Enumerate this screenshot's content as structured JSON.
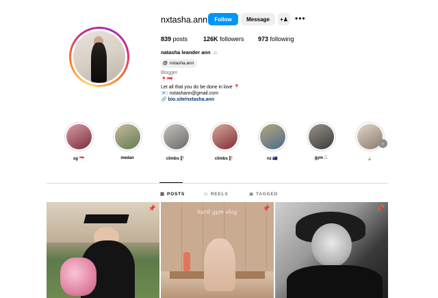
{
  "profile": {
    "username": "nxtasha.ann",
    "follow_label": "Follow",
    "message_label": "Message",
    "add_user_icon": "add-user-icon",
    "more_label": "•••",
    "stats": {
      "posts_count": "839",
      "posts_label": "posts",
      "followers_count": "126K",
      "followers_label": "followers",
      "following_count": "973",
      "following_label": "following"
    },
    "full_name": "natasha leander ann",
    "name_emoji": "☁️",
    "threads_handle": "nxtasha.ann",
    "category": "Blogger",
    "bio_line1": "📍🇸🇬",
    "bio_line2": "Let all that you do be done in love 📍",
    "bio_line3": "📧: nxtashann@gmail.com",
    "link": "bio.site/nxtasha.ann"
  },
  "highlights": [
    {
      "label": "sg 🇸🇬",
      "colors": [
        "#7a2f3a",
        "#d89aa4"
      ]
    },
    {
      "label": "medan",
      "colors": [
        "#5e7d52",
        "#cbb79c"
      ]
    },
    {
      "label": "climbs 🧗🏻",
      "colors": [
        "#6a6a6a",
        "#c6c2bb"
      ]
    },
    {
      "label": "climbs 🧗🏻",
      "colors": [
        "#7e2d37",
        "#d8a99a"
      ]
    },
    {
      "label": "nz 🇳🇿",
      "colors": [
        "#4a6d8c",
        "#b8a67e"
      ]
    },
    {
      "label": "gym 🏻",
      "colors": [
        "#3a3a3a",
        "#9a9288"
      ]
    },
    {
      "label": "🍃",
      "colors": [
        "#8a7b6b",
        "#e0d6cb"
      ]
    }
  ],
  "tabs": [
    {
      "label": "POSTS",
      "icon": "grid-icon",
      "active": true
    },
    {
      "label": "REELS",
      "icon": "reels-icon",
      "active": false
    },
    {
      "label": "TAGGED",
      "icon": "tagged-icon",
      "active": false
    }
  ],
  "posts": [
    {
      "pinned": true
    },
    {
      "pinned": true,
      "caption": "hard gym vlog"
    },
    {
      "pinned": true
    }
  ],
  "colors": {
    "accent": "#0095f6",
    "link": "#00376b",
    "muted": "#737373"
  }
}
